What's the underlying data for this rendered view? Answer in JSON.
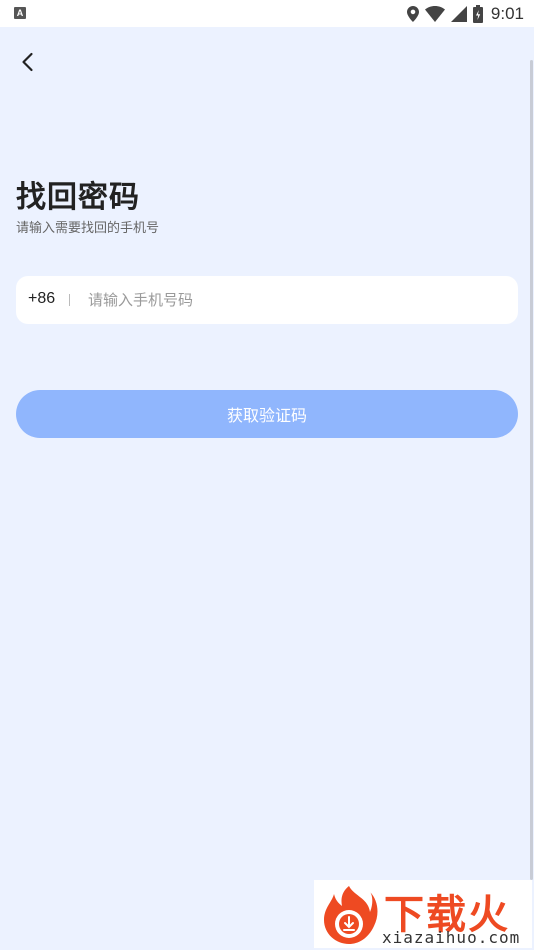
{
  "status_bar": {
    "left_icon_letter": "A",
    "icons": [
      "location-icon",
      "wifi-icon",
      "signal-icon",
      "battery-icon"
    ],
    "time": "9:01"
  },
  "header": {
    "back_icon": "chevron-left-icon"
  },
  "page": {
    "title": "找回密码",
    "subtitle": "请输入需要找回的手机号"
  },
  "phone_form": {
    "country_code": "+86",
    "phone_value": "",
    "phone_placeholder": "请输入手机号码"
  },
  "actions": {
    "get_code_label": "获取验证码",
    "button_color": "#90b6fd"
  },
  "watermark": {
    "brand": "下载火",
    "url": "xiazaihuo.com",
    "color": "#ee4a22"
  },
  "colors": {
    "background": "#ecf2ff",
    "input_bg": "#ffffff"
  }
}
